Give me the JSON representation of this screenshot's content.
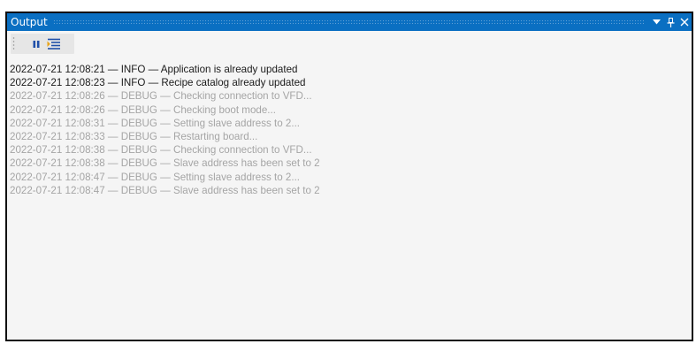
{
  "panel": {
    "title": "Output",
    "buttons": {
      "dropdown": "▼",
      "pin": "📌",
      "close": "✕"
    }
  },
  "toolbar": {
    "pause_icon": "pause-icon",
    "wrap_icon": "word-wrap-icon"
  },
  "log": {
    "lines": [
      {
        "text": "2022-07-21 12:08:21 — INFO — Application is already updated",
        "level": "INFO"
      },
      {
        "text": "2022-07-21 12:08:23 — INFO — Recipe catalog already updated",
        "level": "INFO"
      },
      {
        "text": "2022-07-21 12:08:26 — DEBUG — Checking connection to VFD...",
        "level": "DEBUG"
      },
      {
        "text": "2022-07-21 12:08:26 — DEBUG — Checking boot mode...",
        "level": "DEBUG"
      },
      {
        "text": "2022-07-21 12:08:31 — DEBUG — Setting slave address to 2...",
        "level": "DEBUG"
      },
      {
        "text": "2022-07-21 12:08:33 — DEBUG — Restarting board...",
        "level": "DEBUG"
      },
      {
        "text": "2022-07-21 12:08:38 — DEBUG — Checking connection to VFD...",
        "level": "DEBUG"
      },
      {
        "text": "2022-07-21 12:08:38 — DEBUG — Slave address has been set to 2",
        "level": "DEBUG"
      },
      {
        "text": "2022-07-21 12:08:47 — DEBUG — Setting slave address to 2...",
        "level": "DEBUG"
      },
      {
        "text": "2022-07-21 12:08:47 — DEBUG — Slave address has been set to 2",
        "level": "DEBUG"
      }
    ]
  },
  "colors": {
    "title_bar": "#0a6fc2",
    "info_text": "#1b1b1b",
    "debug_text": "#a5a5a5",
    "background": "#f5f5f5"
  }
}
